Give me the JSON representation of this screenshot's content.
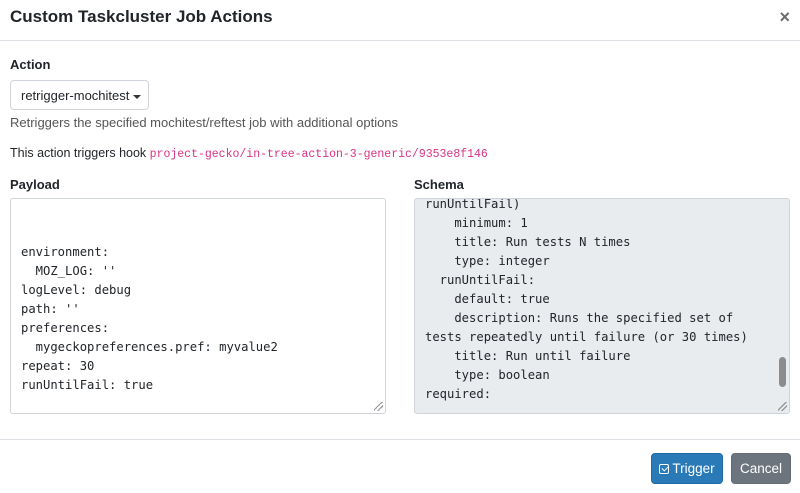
{
  "modal": {
    "title": "Custom Taskcluster Job Actions",
    "close_icon": "×"
  },
  "action": {
    "label": "Action",
    "selected": "retrigger-mochitest",
    "description": "Retriggers the specified mochitest/reftest job with additional options"
  },
  "hook": {
    "prefix": "This action triggers hook",
    "id": "project-gecko/in-tree-action-3-generic/9353e8f146"
  },
  "payload": {
    "label": "Payload",
    "text": "environment:\n  MOZ_LOG: ''\nlogLevel: debug\npath: ''\npreferences:\n  mygeckopreferences.pref: myvalue2\nrepeat: 30\nrunUntilFail: true"
  },
  "schema": {
    "label": "Schema",
    "text": "runUntilFail)\n    minimum: 1\n    title: Run tests N times\n    type: integer\n  runUntilFail:\n    default: true\n    description: Runs the specified set of\ntests repeatedly until failure (or 30 times)\n    title: Run until failure\n    type: boolean\nrequired:"
  },
  "buttons": {
    "trigger": "Trigger",
    "cancel": "Cancel"
  },
  "icons": {
    "close": "close-icon",
    "caret": "caret-down-icon",
    "trigger": "check-square-icon"
  }
}
